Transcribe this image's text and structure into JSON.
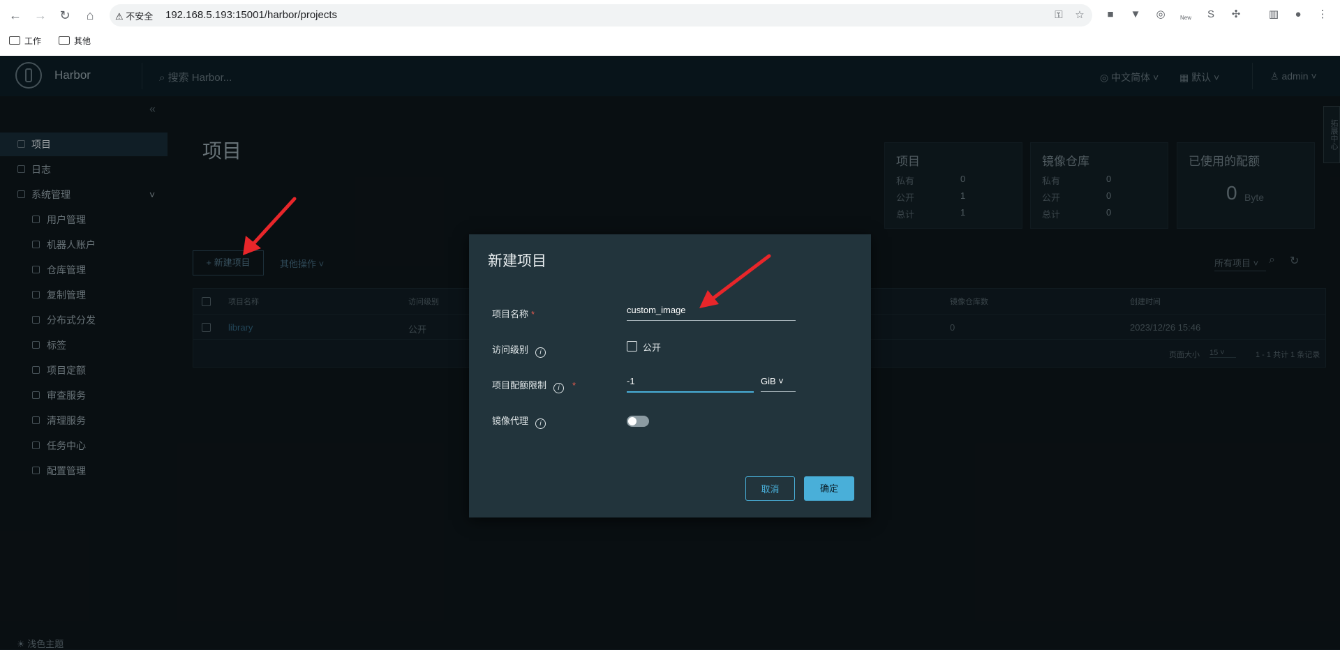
{
  "browser": {
    "insecure_label": "不安全",
    "url": "192.168.5.193:15001/harbor/projects",
    "bookmarks": [
      "工作",
      "其他"
    ],
    "new_badge": "New"
  },
  "header": {
    "brand": "Harbor",
    "search_placeholder": "搜索 Harbor...",
    "language": "中文简体",
    "theme_default": "默认",
    "user": "admin"
  },
  "sidebar": {
    "items": [
      {
        "label": "项目"
      },
      {
        "label": "日志"
      },
      {
        "label": "系统管理"
      },
      {
        "label": "用户管理"
      },
      {
        "label": "机器人账户"
      },
      {
        "label": "仓库管理"
      },
      {
        "label": "复制管理"
      },
      {
        "label": "分布式分发"
      },
      {
        "label": "标签"
      },
      {
        "label": "项目定额"
      },
      {
        "label": "审查服务"
      },
      {
        "label": "清理服务"
      },
      {
        "label": "任务中心"
      },
      {
        "label": "配置管理"
      }
    ],
    "light_theme": "浅色主题"
  },
  "page": {
    "title": "项目",
    "new_project_button": "+ 新建项目",
    "more_actions": "其他操作",
    "filter": "所有项目",
    "side_tab": "拓展中心"
  },
  "cards": {
    "projects": {
      "title": "项目",
      "private_label": "私有",
      "private": "0",
      "public_label": "公开",
      "public": "1",
      "total_label": "总计",
      "total": "1"
    },
    "repos": {
      "title": "镜像仓库",
      "private_label": "私有",
      "private": "0",
      "public_label": "公开",
      "public": "0",
      "total_label": "总计",
      "total": "0"
    },
    "quota": {
      "title": "已使用的配额",
      "value": "0",
      "unit": "Byte"
    }
  },
  "table": {
    "headers": [
      "项目名称",
      "访问级别",
      "镜像仓库数",
      "创建时间"
    ],
    "rows": [
      {
        "name": "library",
        "access": "公开",
        "repo_count": "0",
        "created": "2023/12/26 15:46"
      }
    ],
    "page_size_label": "页面大小",
    "page_size": "15",
    "summary": "1 - 1 共计 1 条记录"
  },
  "modal": {
    "title": "新建项目",
    "name_label": "项目名称",
    "name_value": "custom_image",
    "access_label": "访问级别",
    "public_label": "公开",
    "quota_label": "项目配额限制",
    "quota_value": "-1",
    "quota_unit": "GiB",
    "proxy_label": "镜像代理",
    "cancel": "取消",
    "ok": "确定"
  },
  "colors": {
    "accent": "#49afd9",
    "annotation_arrow": "#e8262a",
    "modal_bg": "#22343c",
    "page_bg": "#0d1418"
  }
}
